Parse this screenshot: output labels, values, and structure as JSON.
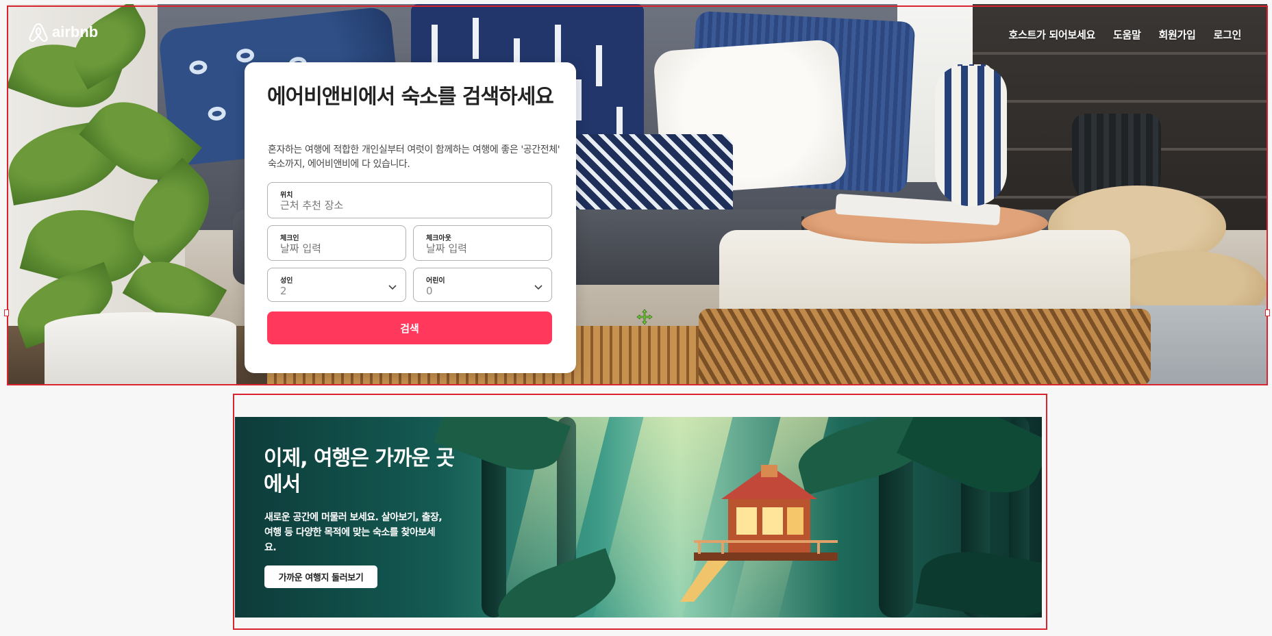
{
  "brand": {
    "name": "airbnb",
    "logo_icon": "airbnb-logo-icon"
  },
  "nav": {
    "items": [
      "호스트가 되어보세요",
      "도움말",
      "회원가입",
      "로그인"
    ]
  },
  "search_card": {
    "title": "에어비앤비에서 숙소를 검색하세요",
    "description": "혼자하는 여행에 적합한 개인실부터 여럿이 함께하는 여행에 좋은 '공간전체' 숙소까지, 에어비앤비에 다 있습니다.",
    "location": {
      "label": "위치",
      "placeholder": "근처 추천 장소"
    },
    "checkin": {
      "label": "체크인",
      "placeholder": "날짜 입력"
    },
    "checkout": {
      "label": "체크아웃",
      "placeholder": "날짜 입력"
    },
    "adults": {
      "label": "성인",
      "value": "2"
    },
    "children": {
      "label": "어린이",
      "value": "0"
    },
    "search_button": "검색"
  },
  "promo": {
    "title": "이제, 여행은 가까운 곳에서",
    "description": "새로운 공간에 머물러 보세요. 살아보기, 출장, 여행 등 다양한 목적에 맞는 숙소를 찾아보세요.",
    "button": "가까운 여행지 둘러보기"
  },
  "colors": {
    "accent": "#ff385c",
    "selection_outline": "#d9232e",
    "text_dark": "#222222"
  }
}
